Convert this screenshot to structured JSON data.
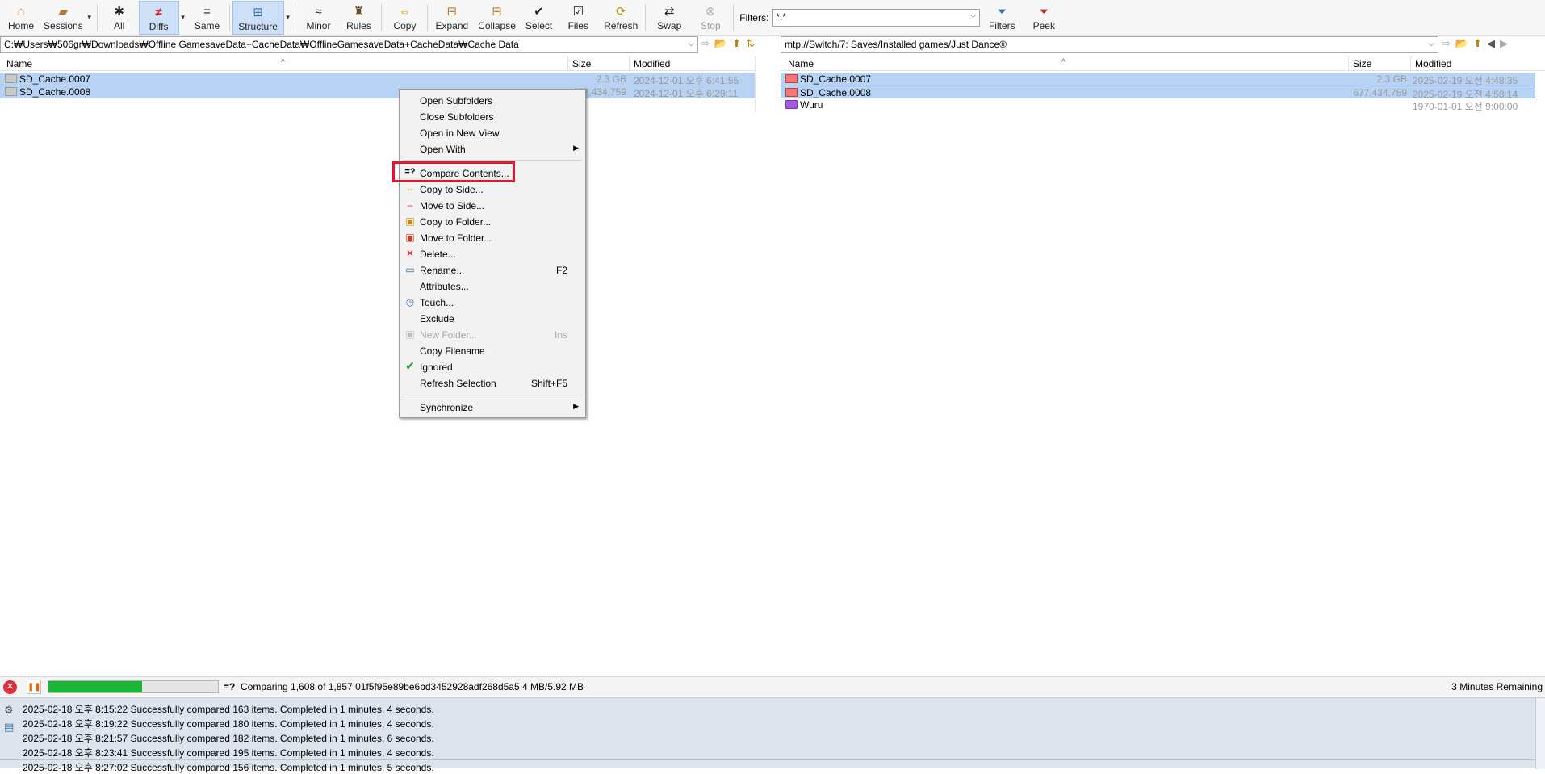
{
  "toolbar": {
    "home": "Home",
    "sessions": "Sessions",
    "all": "All",
    "diffs": "Diffs",
    "same": "Same",
    "structure": "Structure",
    "minor": "Minor",
    "rules": "Rules",
    "copy": "Copy",
    "expand": "Expand",
    "collapse": "Collapse",
    "select": "Select",
    "files": "Files",
    "refresh": "Refresh",
    "swap": "Swap",
    "stop": "Stop",
    "filters_label": "Filters:",
    "filters_value": "*.*",
    "filters": "Filters",
    "peek": "Peek"
  },
  "left": {
    "path": "C:₩Users₩506gr₩Downloads₩Offline GamesaveData+CacheData₩OfflineGamesaveData+CacheData₩Cache Data",
    "columns": {
      "name": "Name",
      "size": "Size",
      "modified": "Modified"
    },
    "rows": [
      {
        "name": "SD_Cache.0007",
        "size": "2.3 GB",
        "modified": "2024-12-01 오후 6:41:55"
      },
      {
        "name": "SD_Cache.0008",
        "size": "677,434,759",
        "modified": "2024-12-01 오후 6:29:11"
      }
    ]
  },
  "right": {
    "path": "mtp://Switch/7: Saves/Installed games/Just Dance®",
    "columns": {
      "name": "Name",
      "size": "Size",
      "modified": "Modified"
    },
    "rows": [
      {
        "name": "SD_Cache.0007",
        "size": "2.3 GB",
        "modified": "2025-02-19 오전 4:48:35"
      },
      {
        "name": "SD_Cache.0008",
        "size": "677,434,759",
        "modified": "2025-02-19 오전 4:58:14"
      },
      {
        "name": "Wuru",
        "size": "",
        "modified": "1970-01-01 오전 9:00:00"
      }
    ]
  },
  "context_menu": {
    "open_subfolders": "Open Subfolders",
    "close_subfolders": "Close Subfolders",
    "open_new_view": "Open in New View",
    "open_with": "Open With",
    "compare_contents": "Compare Contents...",
    "compare_icon": "=?",
    "copy_to_side": "Copy to Side...",
    "move_to_side": "Move to Side...",
    "copy_to_folder": "Copy to Folder...",
    "move_to_folder": "Move to Folder...",
    "delete": "Delete...",
    "rename": "Rename...",
    "rename_key": "F2",
    "attributes": "Attributes...",
    "touch": "Touch...",
    "exclude": "Exclude",
    "new_folder": "New Folder...",
    "new_folder_key": "Ins",
    "copy_filename": "Copy Filename",
    "ignored": "Ignored",
    "refresh_selection": "Refresh Selection",
    "refresh_selection_key": "Shift+F5",
    "synchronize": "Synchronize"
  },
  "status": {
    "compare_icon": "=?",
    "progress_text": "Comparing 1,608 of 1,857  01f5f95e89be6bd3452928adf268d5a5   4 MB/5.92 MB",
    "progress_fraction": 0.55,
    "remaining": "3 Minutes Remaining"
  },
  "log": [
    "2025-02-18 오후 8:15:22  Successfully compared 163 items.  Completed in 1 minutes, 4 seconds.",
    "2025-02-18 오후 8:19:22  Successfully compared 180 items.  Completed in 1 minutes, 4 seconds.",
    "2025-02-18 오후 8:21:57  Successfully compared 182 items.  Completed in 1 minutes, 6 seconds.",
    "2025-02-18 오후 8:23:41  Successfully compared 195 items.  Completed in 1 minutes, 4 seconds.",
    "2025-02-18 오후 8:27:02  Successfully compared 156 items.  Completed in 1 minutes, 5 seconds."
  ],
  "colors": {
    "selection": "#b7d2f3",
    "highlight": "#e0182e",
    "progress": "#1ab534"
  }
}
